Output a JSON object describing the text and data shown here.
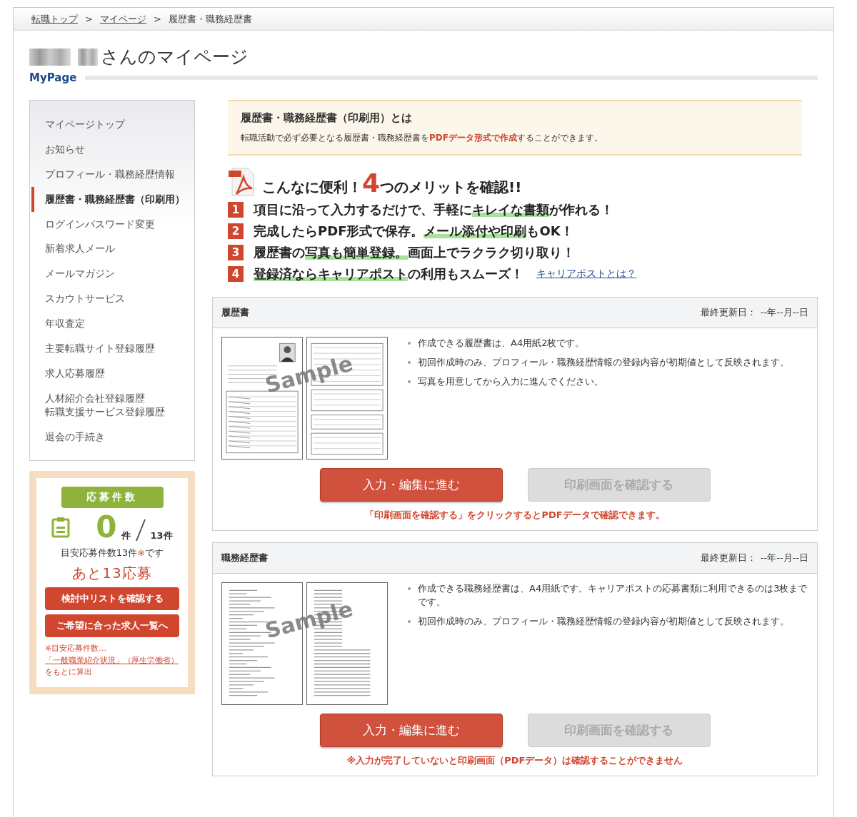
{
  "breadcrumb": [
    {
      "label": "転職トップ",
      "link": true
    },
    {
      "label": "マイページ",
      "link": true
    },
    {
      "label": "履歴書・職務経歴書",
      "link": false
    }
  ],
  "breadcrumb_separator": ">",
  "page_title": {
    "suffix": "さんのマイページ",
    "subtitle": "MyPage"
  },
  "sidebar": {
    "items": [
      {
        "label": "マイページトップ",
        "selected": false
      },
      {
        "label": "お知らせ",
        "selected": false
      },
      {
        "label": "プロフィール・職務経歴情報",
        "selected": false
      },
      {
        "label": "履歴書・職務経歴書（印刷用）",
        "selected": true
      },
      {
        "label": "ログインパスワード変更",
        "selected": false
      },
      {
        "label": "新着求人メール",
        "selected": false
      },
      {
        "label": "メールマガジン",
        "selected": false
      },
      {
        "label": "スカウトサービス",
        "selected": false
      },
      {
        "label": "年収査定",
        "selected": false
      },
      {
        "label": "主要転職サイト登録履歴",
        "selected": false
      },
      {
        "label": "求人応募履歴",
        "selected": false
      },
      {
        "label": "人材紹介会社登録履歴",
        "selected": false,
        "joined_with_next": true
      },
      {
        "label": "転職支援サービス登録履歴",
        "selected": false
      },
      {
        "label": "退会の手続き",
        "selected": false
      }
    ]
  },
  "application_widget": {
    "title": "応募件数",
    "count": "0",
    "count_unit": "件",
    "total": "13件",
    "target": [
      {
        "text": "目安応募件数13件",
        "accent": false
      },
      {
        "text": "※",
        "accent": true
      },
      {
        "text": "です",
        "accent": false
      }
    ],
    "remaining": "あと13応募",
    "buttons": [
      "検討中リストを確認する",
      "ご希望に合った求人一覧へ"
    ],
    "footnote": {
      "before": "※目安応募件数…",
      "link": "「一般職業紹介状況」（厚生労働省）",
      "after": "をもとに算出"
    }
  },
  "intro": {
    "title": "履歴書・職務経歴書（印刷用）とは",
    "text": [
      {
        "text": "転職活動で必ず必要となる履歴書・職務経歴書を",
        "accent": false
      },
      {
        "text": "PDFデータ形式で作成",
        "accent": true
      },
      {
        "text": "することができます。",
        "accent": false
      }
    ]
  },
  "merits": {
    "heading": [
      {
        "text": "こんなに便利！",
        "accent": false
      },
      {
        "text": "4",
        "accent": true
      },
      {
        "text": "つのメリットを確認!!",
        "accent": false
      }
    ],
    "items": [
      {
        "number": "1",
        "parts": [
          {
            "text": "項目に沿って入力するだけで、手軽に",
            "highlight": false
          },
          {
            "text": "キレイな書類",
            "highlight": true
          },
          {
            "text": "が作れる！",
            "highlight": false
          }
        ]
      },
      {
        "number": "2",
        "parts": [
          {
            "text": "完成したらPDF形式で保存。",
            "highlight": false
          },
          {
            "text": "メール添付や印刷",
            "highlight": true
          },
          {
            "text": "もOK！",
            "highlight": false
          }
        ]
      },
      {
        "number": "3",
        "parts": [
          {
            "text": "履歴書の",
            "highlight": false
          },
          {
            "text": "写真も簡単登録。",
            "highlight": true
          },
          {
            "text": "画面上でラクラク切り取り！",
            "highlight": false
          }
        ]
      },
      {
        "number": "4",
        "parts": [
          {
            "text": "登録済ならキャリアポスト",
            "highlight": true
          },
          {
            "text": "の利用もスムーズ！",
            "highlight": false
          }
        ],
        "link": "キャリアポストとは？"
      }
    ]
  },
  "documents": [
    {
      "kind": "resume",
      "title": "履歴書",
      "updated_label": "最終更新日：",
      "updated": "--年--月--日",
      "sample_label": "Sample",
      "notes": [
        "作成できる履歴書は、A4用紙2枚です。",
        "初回作成時のみ、プロフィール・職務経歴情報の登録内容が初期値として反映されます。",
        "写真を用意してから入力に進んでください。"
      ],
      "buttons": [
        {
          "label": "入力・編集に進む",
          "disabled": false
        },
        {
          "label": "印刷画面を確認する",
          "disabled": true
        }
      ],
      "message": "「印刷画面を確認する」をクリックするとPDFデータで確認できます。"
    },
    {
      "kind": "cv",
      "title": "職務経歴書",
      "updated_label": "最終更新日：",
      "updated": "--年--月--日",
      "sample_label": "Sample",
      "notes": [
        "作成できる職務経歴書は、A4用紙です。キャリアポストの応募書類に利用できるのは3枚までです。",
        "初回作成時のみ、プロフィール・職務経歴情報の登録内容が初期値として反映されます。"
      ],
      "buttons": [
        {
          "label": "入力・編集に進む",
          "disabled": false
        },
        {
          "label": "印刷画面を確認する",
          "disabled": true
        }
      ],
      "message": "※入力が完了していないと印刷画面（PDFデータ）は確認することができません"
    }
  ]
}
